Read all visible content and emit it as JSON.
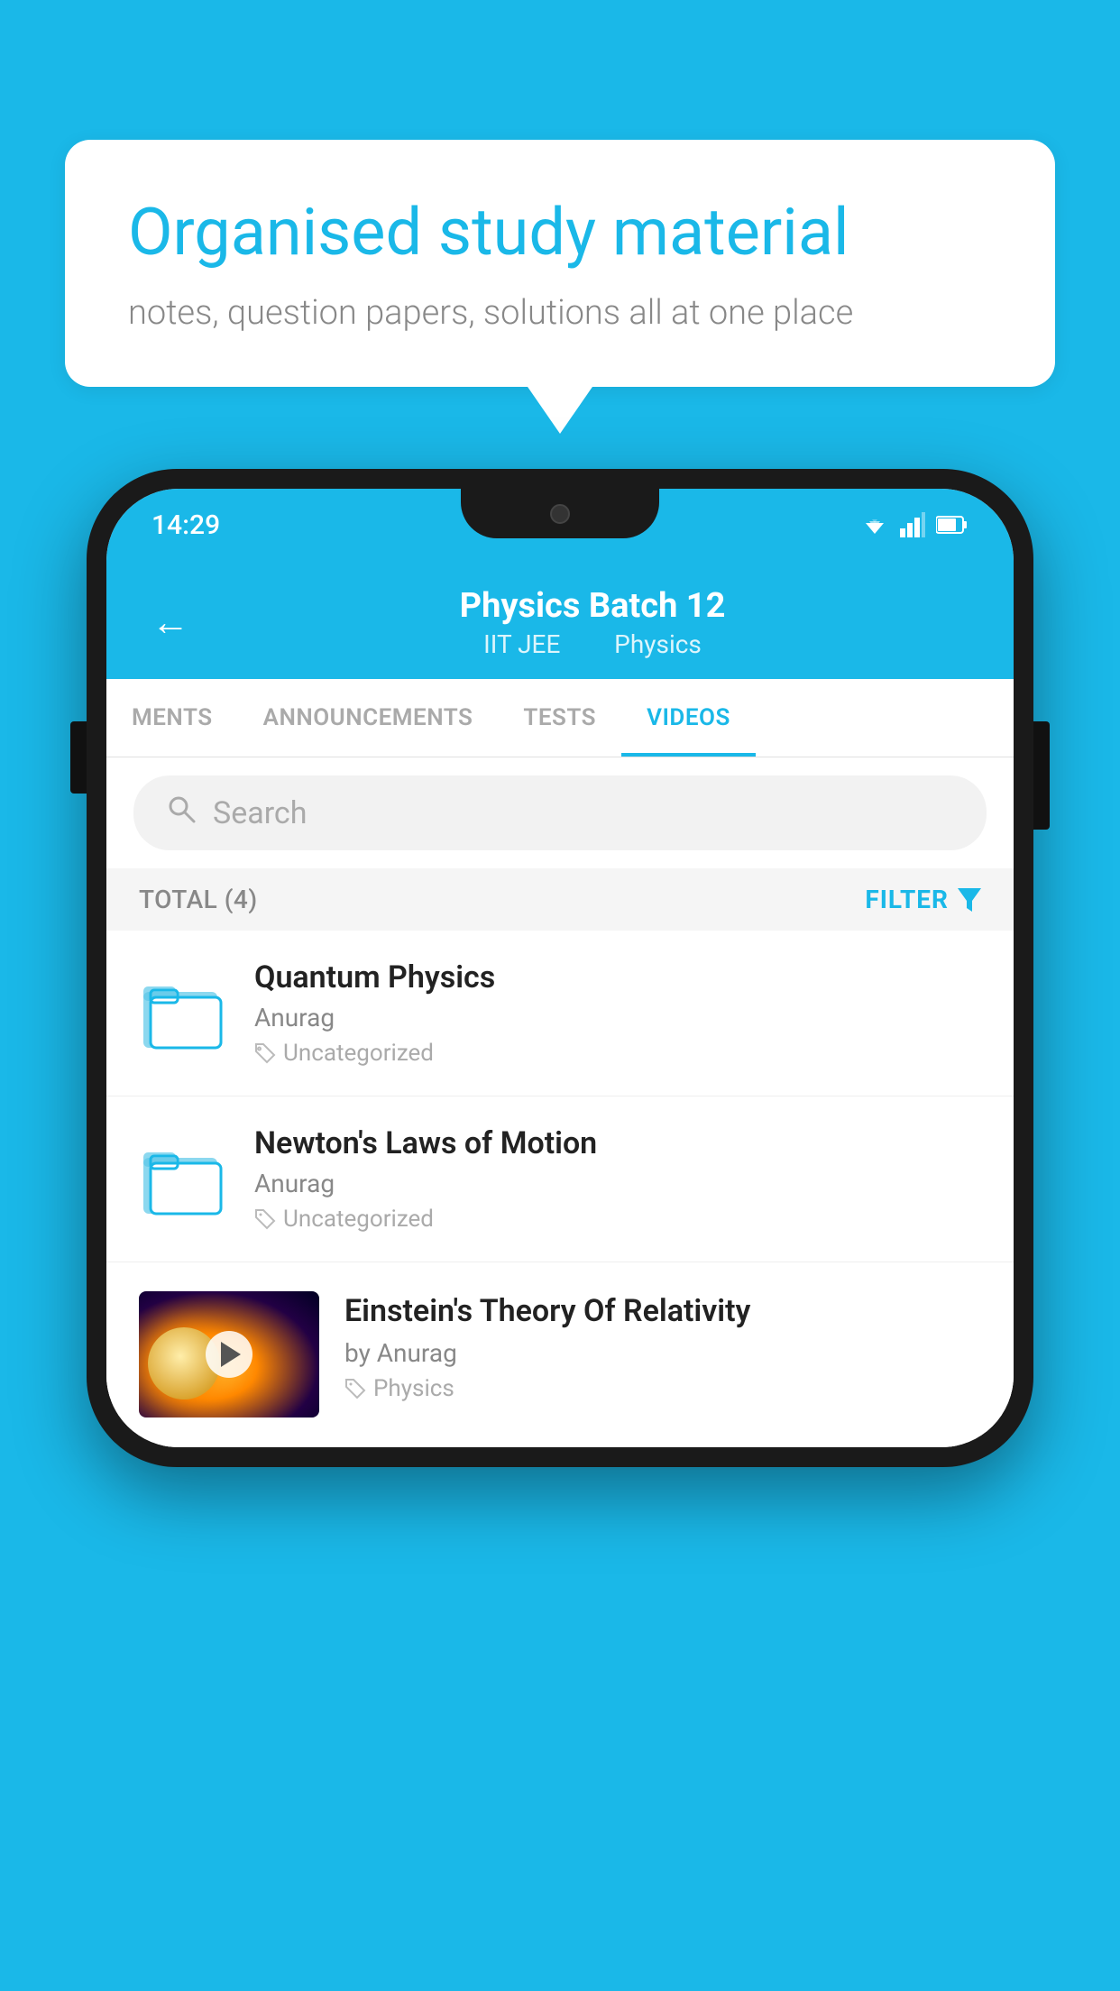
{
  "background": {
    "color": "#1ab8e8"
  },
  "speech_bubble": {
    "title": "Organised study material",
    "subtitle": "notes, question papers, solutions all at one place"
  },
  "phone": {
    "status_bar": {
      "time": "14:29"
    },
    "header": {
      "back_label": "←",
      "title": "Physics Batch 12",
      "subtitle_left": "IIT JEE",
      "subtitle_right": "Physics"
    },
    "tabs": [
      {
        "label": "MENTS",
        "active": false
      },
      {
        "label": "ANNOUNCEMENTS",
        "active": false
      },
      {
        "label": "TESTS",
        "active": false
      },
      {
        "label": "VIDEOS",
        "active": true
      }
    ],
    "search": {
      "placeholder": "Search"
    },
    "filter": {
      "total_label": "TOTAL (4)",
      "filter_label": "FILTER"
    },
    "videos": [
      {
        "id": 1,
        "title": "Quantum Physics",
        "author": "Anurag",
        "tag": "Uncategorized",
        "has_thumbnail": false
      },
      {
        "id": 2,
        "title": "Newton's Laws of Motion",
        "author": "Anurag",
        "tag": "Uncategorized",
        "has_thumbnail": false
      },
      {
        "id": 3,
        "title": "Einstein's Theory Of Relativity",
        "author": "by Anurag",
        "tag": "Physics",
        "has_thumbnail": true
      }
    ]
  }
}
